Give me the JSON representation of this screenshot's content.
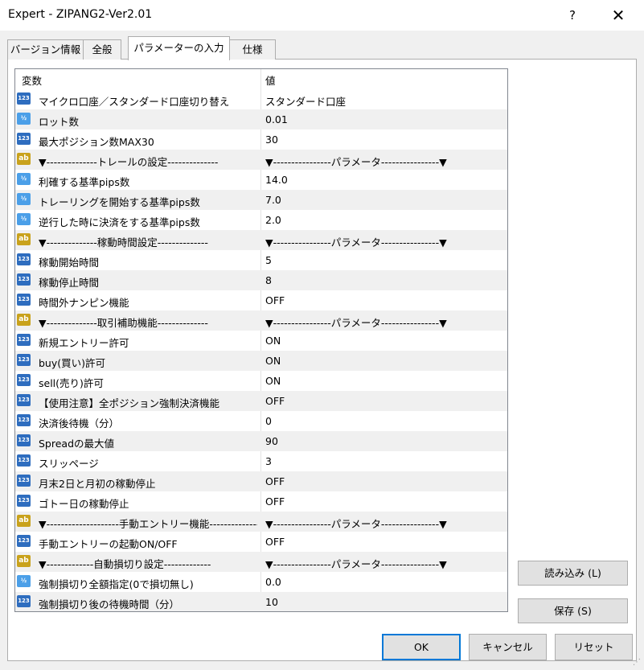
{
  "window": {
    "title": "Expert - ZIPANG2-Ver2.01",
    "help_label": "?",
    "close_label": "✕"
  },
  "tabs": [
    {
      "label": "バージョン情報"
    },
    {
      "label": "全般"
    },
    {
      "label": "パラメーターの入力"
    },
    {
      "label": "仕様"
    }
  ],
  "active_tab": 2,
  "grid": {
    "headers": {
      "name": "変数",
      "value": "値"
    },
    "rows": [
      {
        "icon": "int",
        "name": "マイクロ口座／スタンダード口座切り替え",
        "value": "スタンダード口座"
      },
      {
        "icon": "double",
        "name": "ロット数",
        "value": "0.01"
      },
      {
        "icon": "int",
        "name": "最大ポジション数MAX30",
        "value": "30"
      },
      {
        "icon": "string",
        "name": "▼--------------トレールの設定--------------",
        "value": "▼----------------パラメータ----------------▼"
      },
      {
        "icon": "double",
        "name": "利確する基準pips数",
        "value": "14.0"
      },
      {
        "icon": "double",
        "name": "トレーリングを開始する基準pips数",
        "value": "7.0"
      },
      {
        "icon": "double",
        "name": "逆行した時に決済をする基準pips数",
        "value": "2.0"
      },
      {
        "icon": "string",
        "name": "▼--------------稼動時間設定--------------",
        "value": "▼----------------パラメータ----------------▼"
      },
      {
        "icon": "int",
        "name": "稼動開始時間",
        "value": "5"
      },
      {
        "icon": "int",
        "name": "稼動停止時間",
        "value": "8"
      },
      {
        "icon": "int",
        "name": "時間外ナンピン機能",
        "value": "OFF"
      },
      {
        "icon": "string",
        "name": "▼--------------取引補助機能--------------",
        "value": "▼----------------パラメータ----------------▼"
      },
      {
        "icon": "int",
        "name": "新規エントリー許可",
        "value": "ON"
      },
      {
        "icon": "int",
        "name": "buy(買い)許可",
        "value": "ON"
      },
      {
        "icon": "int",
        "name": "sell(売り)許可",
        "value": "ON"
      },
      {
        "icon": "int",
        "name": "【使用注意】全ポジション強制決済機能",
        "value": "OFF"
      },
      {
        "icon": "int",
        "name": "決済後待機（分）",
        "value": "0"
      },
      {
        "icon": "int",
        "name": "Spreadの最大値",
        "value": "90"
      },
      {
        "icon": "int",
        "name": "スリッページ",
        "value": "3"
      },
      {
        "icon": "int",
        "name": "月末2日と月初の稼動停止",
        "value": "OFF"
      },
      {
        "icon": "int",
        "name": "ゴトー日の稼動停止",
        "value": "OFF"
      },
      {
        "icon": "string",
        "name": "▼--------------------手動エントリー機能--------------------",
        "value": "▼----------------パラメータ----------------▼"
      },
      {
        "icon": "int",
        "name": "手動エントリーの起動ON/OFF",
        "value": "OFF"
      },
      {
        "icon": "string",
        "name": "▼-------------自動損切り設定-------------",
        "value": "▼----------------パラメータ----------------▼"
      },
      {
        "icon": "double",
        "name": "強制損切り全額指定(0で損切無し)",
        "value": "0.0"
      },
      {
        "icon": "int",
        "name": "強制損切り後の待機時間（分）",
        "value": "10"
      }
    ]
  },
  "icon_glyphs": {
    "int": "123",
    "double": "½",
    "string": "ab"
  },
  "buttons": {
    "load": "読み込み (L)",
    "save": "保存 (S)",
    "ok": "OK",
    "cancel": "キャンセル",
    "reset": "リセット"
  }
}
